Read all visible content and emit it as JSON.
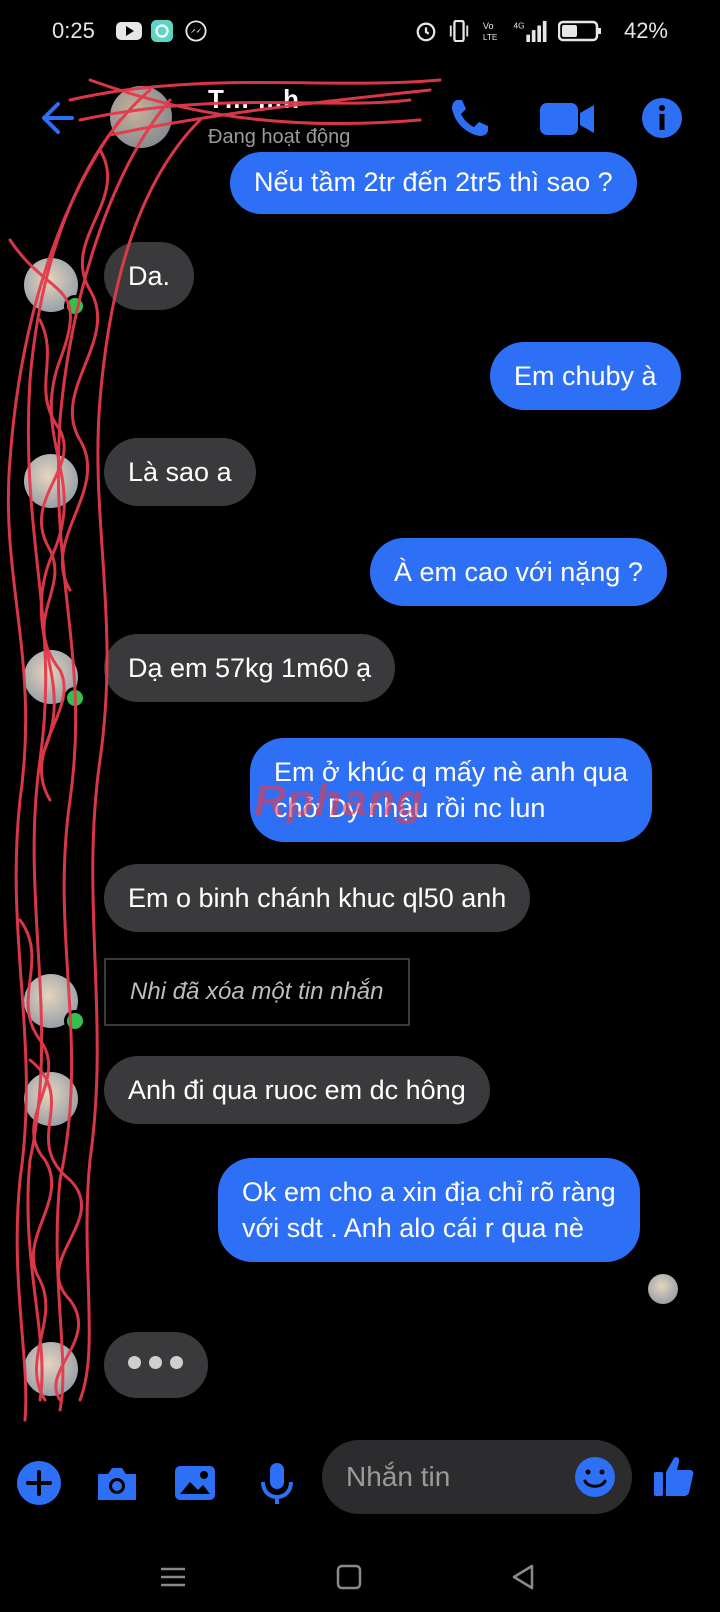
{
  "status_bar": {
    "time": "0:25",
    "battery": "42%",
    "network": "4G"
  },
  "header": {
    "contact_name": "T… …h",
    "contact_status": "Đang hoạt động"
  },
  "messages": [
    {
      "dir": "out",
      "text": "Nếu tầm 2tr đến 2tr5 thì sao ?"
    },
    {
      "dir": "in",
      "text": "Da."
    },
    {
      "dir": "out",
      "text": "Em chuby à"
    },
    {
      "dir": "in",
      "text": "Là sao a"
    },
    {
      "dir": "out",
      "text": "À em cao với nặng ?"
    },
    {
      "dir": "in",
      "text": "Dạ em 57kg 1m60 ạ"
    },
    {
      "dir": "out",
      "line1": "Em ở khúc q mấy nè anh qua",
      "line2": "chở Dy nhậu rồi nc lun"
    },
    {
      "dir": "in",
      "text": "Em o binh chánh khuc ql50 anh"
    },
    {
      "dir": "in",
      "text": "Nhi đã xóa một tin nhắn",
      "deleted": true
    },
    {
      "dir": "in",
      "text": "Anh đi qua ruoc em dc hông"
    },
    {
      "dir": "out",
      "line1": "Ok em cho a xin địa chỉ rõ ràng",
      "line2": "với sdt . Anh alo cái r qua nè"
    }
  ],
  "composer": {
    "placeholder": "Nhắn tin"
  },
  "watermark": "Rphang",
  "icons": [
    "back-arrow",
    "phone",
    "video-camera",
    "info",
    "plus",
    "camera",
    "image",
    "microphone",
    "emoji",
    "thumbs-up"
  ],
  "colors": {
    "accent": "#2d6ff5",
    "incoming_bubble": "#3a3a3c",
    "online": "#31c24d",
    "background": "#000000"
  }
}
